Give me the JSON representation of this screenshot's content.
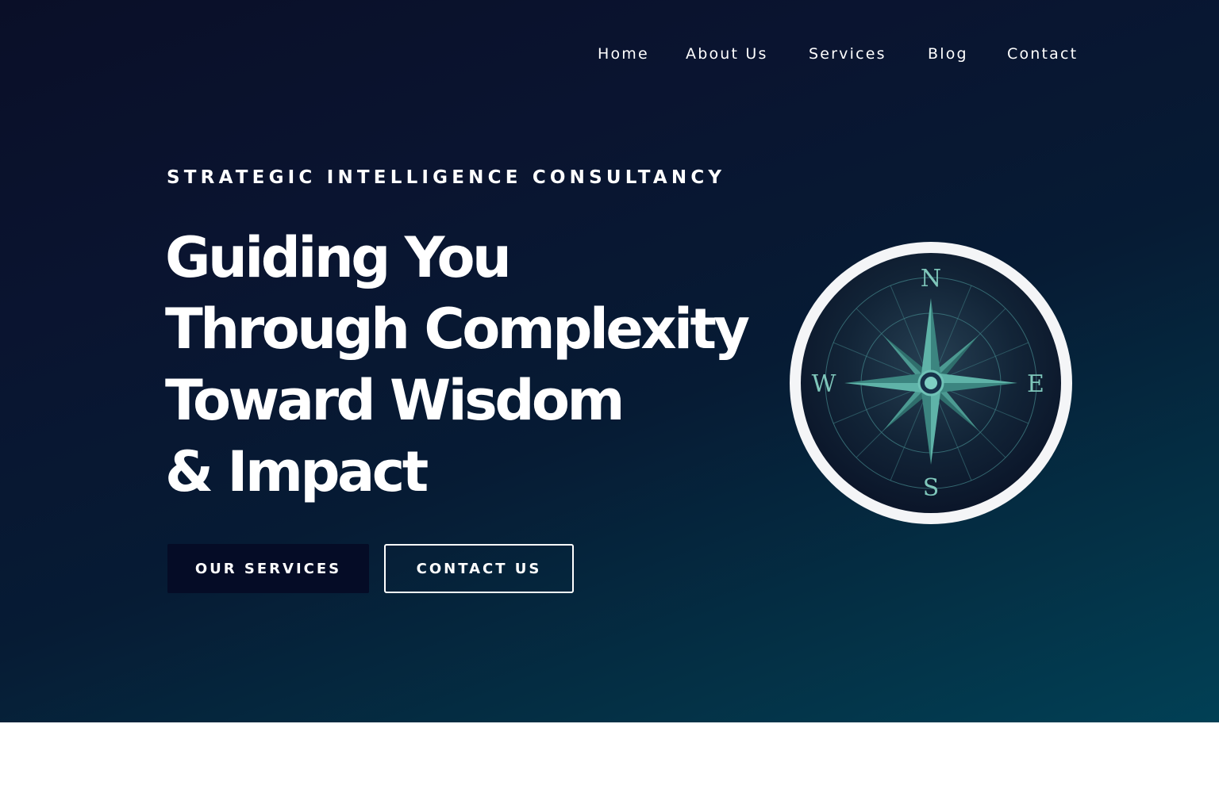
{
  "nav": {
    "items": [
      {
        "label": "Home"
      },
      {
        "label": "About Us"
      },
      {
        "label": "Services"
      },
      {
        "label": "Blog"
      },
      {
        "label": "Contact"
      }
    ]
  },
  "hero": {
    "eyebrow": "STRATEGIC INTELLIGENCE CONSULTANCY",
    "headline_lines": [
      "Guiding You",
      "Through Complexity",
      "Toward Wisdom",
      "& Impact"
    ],
    "primary_button": "OUR SERVICES",
    "secondary_button": "CONTACT US"
  },
  "compass": {
    "icon": "compass-icon",
    "north": "N",
    "east": "E",
    "south": "S",
    "west": "W"
  },
  "colors": {
    "background_top": "#0a0f28",
    "background_bottom": "#014055",
    "accent_teal": "#4fa39b",
    "primary_button": "#050c26"
  }
}
